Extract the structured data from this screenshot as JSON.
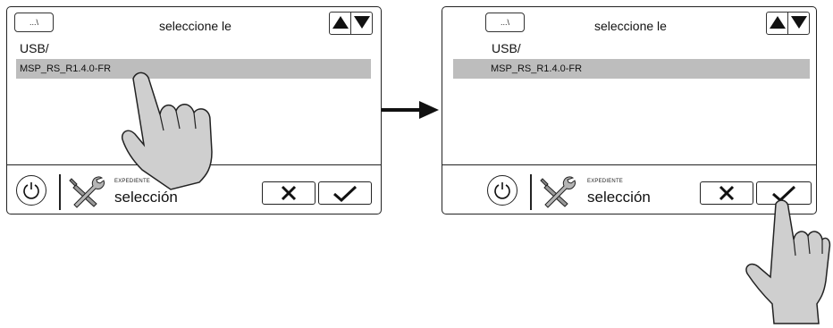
{
  "screen": {
    "path_button": "...\\",
    "title": "seleccione le",
    "folder": "USB/",
    "selected_file": "MSP_RS_R1.4.0-FR"
  },
  "footer": {
    "category_label": "EXPEDIENTE",
    "mode_label": "selección"
  },
  "icons": {
    "power": "power-icon",
    "tools": "wrench-screwdriver-icon",
    "cancel": "x-icon",
    "confirm": "check-icon",
    "scroll_up": "triangle-up-icon",
    "scroll_down": "triangle-down-icon",
    "hand": "pointing-hand-icon",
    "transition": "arrow-right-icon"
  },
  "colors": {
    "selected_row": "#bdbdbd",
    "outline": "#222222",
    "hand_fill": "#cfcfcf"
  }
}
